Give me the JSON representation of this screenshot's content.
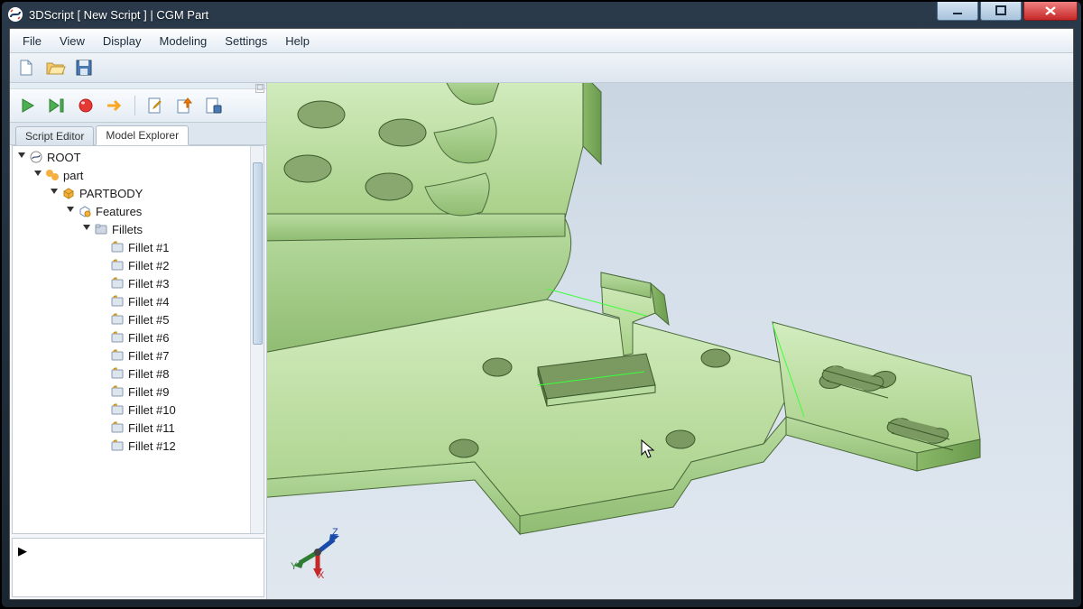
{
  "window": {
    "title": "3DScript [ New Script ] | CGM Part"
  },
  "menubar": [
    "File",
    "View",
    "Display",
    "Modeling",
    "Settings",
    "Help"
  ],
  "main_toolbar": [
    {
      "name": "new-file-icon"
    },
    {
      "name": "open-file-icon"
    },
    {
      "name": "save-file-icon"
    }
  ],
  "script_toolbar": [
    {
      "name": "run-icon",
      "kind": "play"
    },
    {
      "name": "run-step-icon",
      "kind": "play"
    },
    {
      "name": "record-icon",
      "kind": "record"
    },
    {
      "name": "step-over-icon",
      "kind": "arrow"
    },
    {
      "sep": true
    },
    {
      "name": "edit-script-icon",
      "kind": "doc-pencil"
    },
    {
      "name": "export-up-icon",
      "kind": "doc-up"
    },
    {
      "name": "export-config-icon",
      "kind": "doc-gear"
    }
  ],
  "tabs": [
    {
      "label": "Script Editor",
      "active": false
    },
    {
      "label": "Model Explorer",
      "active": true
    }
  ],
  "tree": [
    {
      "indent": 0,
      "twist": "o",
      "icon": "root",
      "label": "ROOT"
    },
    {
      "indent": 1,
      "twist": "o",
      "icon": "part",
      "label": "part"
    },
    {
      "indent": 2,
      "twist": "o",
      "icon": "body",
      "label": "PARTBODY"
    },
    {
      "indent": 3,
      "twist": "o",
      "icon": "feat",
      "label": "Features"
    },
    {
      "indent": 4,
      "twist": "o",
      "icon": "folder",
      "label": "Fillets"
    },
    {
      "indent": 5,
      "twist": "",
      "icon": "fillet",
      "label": "Fillet #1"
    },
    {
      "indent": 5,
      "twist": "",
      "icon": "fillet",
      "label": "Fillet #2"
    },
    {
      "indent": 5,
      "twist": "",
      "icon": "fillet",
      "label": "Fillet #3"
    },
    {
      "indent": 5,
      "twist": "",
      "icon": "fillet",
      "label": "Fillet #4"
    },
    {
      "indent": 5,
      "twist": "",
      "icon": "fillet",
      "label": "Fillet #5"
    },
    {
      "indent": 5,
      "twist": "",
      "icon": "fillet",
      "label": "Fillet #6"
    },
    {
      "indent": 5,
      "twist": "",
      "icon": "fillet",
      "label": "Fillet #7"
    },
    {
      "indent": 5,
      "twist": "",
      "icon": "fillet",
      "label": "Fillet #8"
    },
    {
      "indent": 5,
      "twist": "",
      "icon": "fillet",
      "label": "Fillet #9"
    },
    {
      "indent": 5,
      "twist": "",
      "icon": "fillet",
      "label": "Fillet #10"
    },
    {
      "indent": 5,
      "twist": "",
      "icon": "fillet",
      "label": "Fillet #11"
    },
    {
      "indent": 5,
      "twist": "",
      "icon": "fillet",
      "label": "Fillet #12"
    }
  ],
  "icons": {
    "root": "root",
    "part": "part",
    "body": "body",
    "feat": "feat",
    "folder": "folder",
    "fillet": "fillet"
  },
  "triad": {
    "x": "X",
    "y": "Y",
    "z": "Z"
  },
  "console_caret": "▶"
}
